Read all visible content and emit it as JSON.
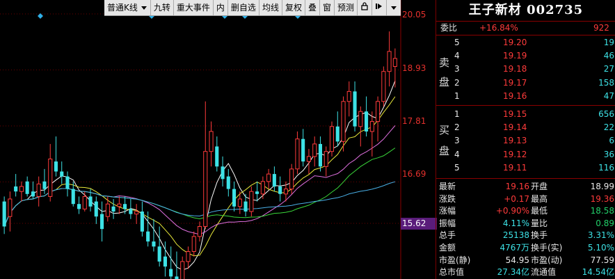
{
  "toolbar": {
    "items": [
      "普通K线",
      "九转",
      "重大事件",
      "内",
      "删自选",
      "均线",
      "复权",
      "叠",
      "窗",
      "预测"
    ],
    "icons": [
      "lock-icon",
      "pin-right-icon",
      "menu-down-icon"
    ]
  },
  "axis": {
    "labels": [
      "20.05",
      "18.93",
      "17.81",
      "16.69"
    ],
    "current_label": "15.62"
  },
  "stock": {
    "title": "王子新材 002735"
  },
  "commission": {
    "label": "委比",
    "ratio": "+16.84%",
    "diff": "922"
  },
  "sell_side_label": "卖盘",
  "buy_side_label": "买盘",
  "sell": [
    {
      "level": "5",
      "price": "19.20",
      "vol": "19"
    },
    {
      "level": "4",
      "price": "19.19",
      "vol": "46"
    },
    {
      "level": "3",
      "price": "19.18",
      "vol": "27"
    },
    {
      "level": "2",
      "price": "19.17",
      "vol": "158"
    },
    {
      "level": "1",
      "price": "19.16",
      "vol": "47"
    }
  ],
  "buy": [
    {
      "level": "1",
      "price": "19.15",
      "vol": "656"
    },
    {
      "level": "2",
      "price": "19.14",
      "vol": "22"
    },
    {
      "level": "3",
      "price": "19.13",
      "vol": "6"
    },
    {
      "level": "4",
      "price": "19.12",
      "vol": "36"
    },
    {
      "level": "5",
      "price": "19.11",
      "vol": "116"
    }
  ],
  "stats": [
    {
      "l1": "最新",
      "v1": "19.16",
      "c1": "red",
      "l2": "开盘",
      "v2": "18.99",
      "c2": "white"
    },
    {
      "l1": "涨跌",
      "v1": "+0.17",
      "c1": "red",
      "l2": "最高",
      "v2": "19.36",
      "c2": "red"
    },
    {
      "l1": "涨幅",
      "v1": "+0.90%",
      "c1": "red",
      "l2": "最低",
      "v2": "18.58",
      "c2": "green"
    },
    {
      "l1": "振幅",
      "v1": "4.11%",
      "c1": "cyan",
      "l2": "量比",
      "v2": "0.89",
      "c2": "green"
    },
    {
      "l1": "总手",
      "v1": "25138",
      "c1": "cyan",
      "l2": "换手",
      "v2": "3.31%",
      "c2": "cyan"
    },
    {
      "l1": "金额",
      "v1": "4767万",
      "c1": "cyan",
      "l2": "换手(实)",
      "v2": "5.10%",
      "c2": "cyan"
    },
    {
      "l1": "市盈(静)",
      "v1": "54.95",
      "c1": "white",
      "l2": "市盈(动)",
      "v2": "77.59",
      "c2": "white"
    },
    {
      "l1": "总市值",
      "v1": "27.34亿",
      "c1": "cyan",
      "l2": "流通值",
      "v2": "14.54亿",
      "c2": "cyan"
    }
  ],
  "chart_data": {
    "type": "candlestick",
    "y_range": [
      14.5,
      20.05
    ],
    "candles": [
      {
        "o": 16.3,
        "h": 16.4,
        "l": 15.65,
        "c": 15.8,
        "up": false
      },
      {
        "o": 16.0,
        "h": 16.5,
        "l": 15.7,
        "c": 16.35,
        "up": true
      },
      {
        "o": 16.6,
        "h": 16.85,
        "l": 16.4,
        "c": 16.5,
        "up": false
      },
      {
        "o": 16.5,
        "h": 16.7,
        "l": 16.3,
        "c": 16.6,
        "up": true
      },
      {
        "o": 16.7,
        "h": 16.8,
        "l": 16.4,
        "c": 16.45,
        "up": false
      },
      {
        "o": 16.5,
        "h": 16.7,
        "l": 16.35,
        "c": 16.4,
        "up": false
      },
      {
        "o": 16.4,
        "h": 16.8,
        "l": 16.2,
        "c": 16.65,
        "up": true
      },
      {
        "o": 16.7,
        "h": 16.95,
        "l": 16.45,
        "c": 16.55,
        "up": false
      },
      {
        "o": 16.4,
        "h": 17.45,
        "l": 16.3,
        "c": 17.15,
        "up": true
      },
      {
        "o": 17.1,
        "h": 17.6,
        "l": 16.8,
        "c": 16.9,
        "up": false
      },
      {
        "o": 16.9,
        "h": 17.1,
        "l": 16.65,
        "c": 16.8,
        "up": false
      },
      {
        "o": 16.8,
        "h": 16.9,
        "l": 16.4,
        "c": 16.55,
        "up": false
      },
      {
        "o": 16.55,
        "h": 16.7,
        "l": 16.2,
        "c": 16.25,
        "up": false
      },
      {
        "o": 16.25,
        "h": 16.4,
        "l": 16.05,
        "c": 16.15,
        "up": false
      },
      {
        "o": 16.15,
        "h": 16.5,
        "l": 16.1,
        "c": 16.4,
        "up": true
      },
      {
        "o": 16.4,
        "h": 16.55,
        "l": 16.1,
        "c": 16.2,
        "up": false
      },
      {
        "o": 16.3,
        "h": 16.4,
        "l": 15.85,
        "c": 16.0,
        "up": false
      },
      {
        "o": 16.05,
        "h": 16.3,
        "l": 15.5,
        "c": 15.75,
        "up": false
      },
      {
        "o": 16.0,
        "h": 16.4,
        "l": 15.9,
        "c": 16.25,
        "up": true
      },
      {
        "o": 16.2,
        "h": 16.35,
        "l": 15.95,
        "c": 16.1,
        "up": false
      },
      {
        "o": 16.2,
        "h": 16.4,
        "l": 16.05,
        "c": 16.25,
        "up": true
      },
      {
        "o": 16.25,
        "h": 16.4,
        "l": 16.05,
        "c": 16.15,
        "up": false
      },
      {
        "o": 16.15,
        "h": 16.35,
        "l": 15.95,
        "c": 16.05,
        "up": false
      },
      {
        "o": 16.05,
        "h": 16.25,
        "l": 15.85,
        "c": 16.1,
        "up": true
      },
      {
        "o": 16.1,
        "h": 16.3,
        "l": 15.6,
        "c": 15.7,
        "up": false
      },
      {
        "o": 15.7,
        "h": 16.1,
        "l": 15.4,
        "c": 15.5,
        "up": false
      },
      {
        "o": 15.5,
        "h": 15.95,
        "l": 15.3,
        "c": 15.4,
        "up": false
      },
      {
        "o": 15.4,
        "h": 15.8,
        "l": 15.0,
        "c": 15.1,
        "up": false
      },
      {
        "o": 15.2,
        "h": 15.5,
        "l": 14.8,
        "c": 15.0,
        "up": false
      },
      {
        "o": 14.95,
        "h": 15.4,
        "l": 14.7,
        "c": 14.8,
        "up": false
      },
      {
        "o": 14.8,
        "h": 15.3,
        "l": 14.6,
        "c": 14.65,
        "up": false
      },
      {
        "o": 14.65,
        "h": 15.2,
        "l": 14.55,
        "c": 15.1,
        "up": true
      },
      {
        "o": 15.1,
        "h": 15.4,
        "l": 14.95,
        "c": 15.3,
        "up": true
      },
      {
        "o": 15.3,
        "h": 15.7,
        "l": 15.2,
        "c": 15.6,
        "up": true
      },
      {
        "o": 15.6,
        "h": 15.9,
        "l": 15.5,
        "c": 15.8,
        "up": true
      },
      {
        "o": 15.8,
        "h": 18.3,
        "l": 15.75,
        "c": 17.3,
        "up": true
      },
      {
        "o": 17.3,
        "h": 17.9,
        "l": 17.0,
        "c": 17.7,
        "up": true
      },
      {
        "o": 17.4,
        "h": 17.6,
        "l": 16.9,
        "c": 17.0,
        "up": false
      },
      {
        "o": 17.0,
        "h": 17.2,
        "l": 16.6,
        "c": 16.75,
        "up": false
      },
      {
        "o": 16.8,
        "h": 16.95,
        "l": 16.4,
        "c": 16.55,
        "up": false
      },
      {
        "o": 16.55,
        "h": 16.7,
        "l": 16.1,
        "c": 16.2,
        "up": false
      },
      {
        "o": 16.2,
        "h": 16.5,
        "l": 16.05,
        "c": 16.35,
        "up": true
      },
      {
        "o": 16.3,
        "h": 16.45,
        "l": 16.0,
        "c": 16.1,
        "up": false
      },
      {
        "o": 16.1,
        "h": 16.6,
        "l": 16.0,
        "c": 16.5,
        "up": true
      },
      {
        "o": 16.5,
        "h": 16.7,
        "l": 16.3,
        "c": 16.45,
        "up": false
      },
      {
        "o": 16.45,
        "h": 16.8,
        "l": 16.35,
        "c": 16.7,
        "up": true
      },
      {
        "o": 16.7,
        "h": 16.95,
        "l": 16.55,
        "c": 16.85,
        "up": true
      },
      {
        "o": 16.85,
        "h": 17.0,
        "l": 16.5,
        "c": 16.6,
        "up": false
      },
      {
        "o": 16.6,
        "h": 16.8,
        "l": 16.3,
        "c": 16.45,
        "up": false
      },
      {
        "o": 16.45,
        "h": 16.7,
        "l": 16.3,
        "c": 16.55,
        "up": true
      },
      {
        "o": 16.55,
        "h": 17.05,
        "l": 16.45,
        "c": 16.95,
        "up": true
      },
      {
        "o": 16.95,
        "h": 17.7,
        "l": 16.85,
        "c": 17.55,
        "up": true
      },
      {
        "o": 17.55,
        "h": 17.75,
        "l": 17.0,
        "c": 17.1,
        "up": false
      },
      {
        "o": 17.1,
        "h": 17.35,
        "l": 16.85,
        "c": 17.2,
        "up": true
      },
      {
        "o": 17.2,
        "h": 17.6,
        "l": 17.0,
        "c": 17.45,
        "up": true
      },
      {
        "o": 17.45,
        "h": 17.6,
        "l": 16.9,
        "c": 17.0,
        "up": false
      },
      {
        "o": 17.0,
        "h": 17.4,
        "l": 16.8,
        "c": 17.3,
        "up": true
      },
      {
        "o": 17.3,
        "h": 17.9,
        "l": 17.2,
        "c": 17.8,
        "up": true
      },
      {
        "o": 17.8,
        "h": 18.1,
        "l": 17.4,
        "c": 17.5,
        "up": false
      },
      {
        "o": 17.5,
        "h": 18.4,
        "l": 17.3,
        "c": 18.3,
        "up": true
      },
      {
        "o": 18.3,
        "h": 18.7,
        "l": 18.0,
        "c": 18.5,
        "up": true
      },
      {
        "o": 18.5,
        "h": 18.7,
        "l": 17.7,
        "c": 17.8,
        "up": false
      },
      {
        "o": 17.8,
        "h": 18.2,
        "l": 17.4,
        "c": 18.1,
        "up": true
      },
      {
        "o": 18.1,
        "h": 18.4,
        "l": 17.6,
        "c": 17.7,
        "up": false
      },
      {
        "o": 17.7,
        "h": 18.1,
        "l": 17.2,
        "c": 17.9,
        "up": true
      },
      {
        "o": 17.9,
        "h": 18.4,
        "l": 17.5,
        "c": 18.3,
        "up": true
      },
      {
        "o": 18.3,
        "h": 19.0,
        "l": 18.2,
        "c": 18.9,
        "up": true
      },
      {
        "o": 18.9,
        "h": 19.7,
        "l": 18.6,
        "c": 19.3,
        "up": true
      },
      {
        "o": 19.0,
        "h": 19.36,
        "l": 18.58,
        "c": 19.16,
        "up": true
      }
    ]
  }
}
